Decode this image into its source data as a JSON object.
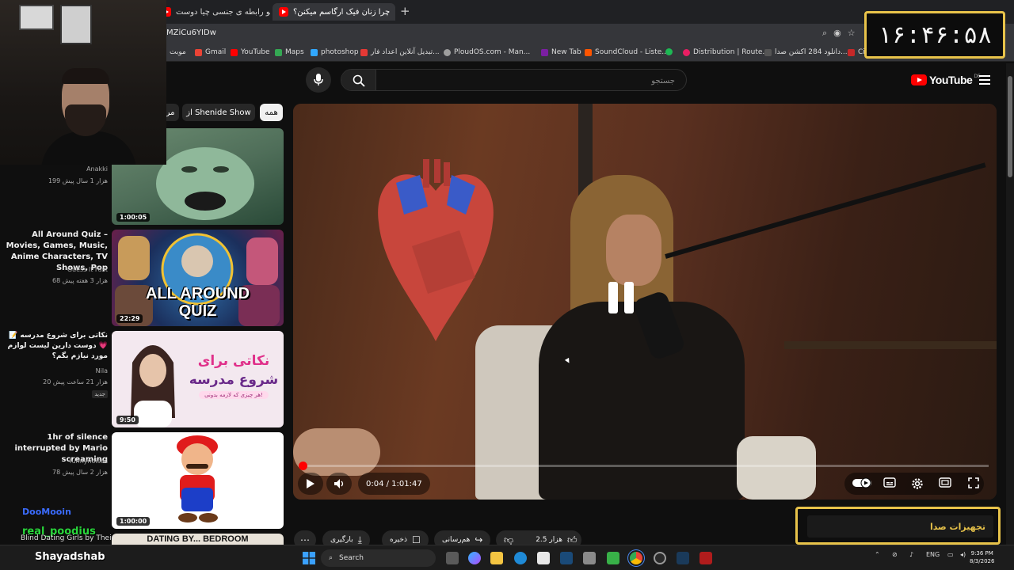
{
  "browser": {
    "tabs": [
      {
        "title": "مزدها تو رابطه ی جنسی چیا دوست...",
        "active": false
      },
      {
        "title": "چرا زنان فیک ارگاسم میکنن؟",
        "active": true
      }
    ],
    "url": "MZiCu6YIDw",
    "bookmarks": [
      {
        "label": "موبت",
        "color": "#9aa0a6"
      },
      {
        "label": "Gmail",
        "color": "#ea4335"
      },
      {
        "label": "YouTube",
        "color": "#ff0000"
      },
      {
        "label": "Maps",
        "color": "#34a853"
      },
      {
        "label": "photoshop",
        "color": "#31a8ff"
      },
      {
        "label": "تبدیل آنلاین اعداد فار...",
        "color": "#e53935"
      },
      {
        "label": "PloudOS.com - Man...",
        "color": "#9e9e9e"
      },
      {
        "label": "New Tab",
        "color": "#7b1fa2"
      },
      {
        "label": "SoundCloud - Liste...",
        "color": "#ff5500"
      },
      {
        "label": "",
        "color": "#1db954"
      },
      {
        "label": "Distribution | Route...",
        "color": "#e91e63"
      },
      {
        "label": "دانلود 284 اکشن صدا...",
        "color": "#555555"
      },
      {
        "label": "Ci",
        "color": "#c62828"
      }
    ]
  },
  "clock_overlay": "۱۶:۴۶:۵۸",
  "youtube": {
    "search_placeholder": "جستجو",
    "logo_text": "YouTube",
    "logo_country": "DE",
    "chips": [
      {
        "label": "همه",
        "selected": true
      },
      {
        "label": "از Shenide Show",
        "selected": false
      },
      {
        "label": "مر",
        "selected": false
      }
    ],
    "recommendations": [
      {
        "title": "",
        "channel": "Anakki",
        "meta": "199 هزار   1 سال پیش",
        "duration": "1:00:05",
        "badge": ""
      },
      {
        "title": "All Around Quiz – Movies, Games, Music, Anime Characters, TV Shows, Pop",
        "channel": "Guess It Fast",
        "meta": "68 هزار   3 هفته پیش",
        "duration": "22:29",
        "badge": ""
      },
      {
        "title": "نکاتی برای شروع مدرسه 📝💗 دوست دارین لیست لوازم مورد نیازم بگم؟",
        "channel": "Nila",
        "meta": "20 هزار   21 ساعت پیش",
        "duration": "9:50",
        "badge": "جدید"
      },
      {
        "title": "1hr of silence interrupted by Mario screaming",
        "channel": "funnynoises",
        "meta": "78 هزار   2 سال پیش",
        "duration": "1:00:00",
        "badge": ""
      }
    ],
    "thumb_texts": {
      "quiz_line1": "ALL AROUND",
      "quiz_line2": "QUIZ",
      "school_line1": "نکاتی برای",
      "school_line2": "شروع مدرسه",
      "school_sub": "هر چیزی که لازمه بدونی!",
      "partial_title": "DATING BY... BEDROOM"
    },
    "player": {
      "current_time": "0:04",
      "duration": "1:01:47",
      "time_display": "0:04 / 1:01:47",
      "progress_fraction": 0.001
    },
    "actions": {
      "like_count": "2.5 هزار",
      "share": "هم‌رسانی",
      "save": "ذخیره",
      "download": "بارگیری"
    }
  },
  "overlays": {
    "banner_text": "تجهیزات صدا",
    "chat": [
      {
        "text": "DooMooin",
        "color": "#3b6cff"
      },
      {
        "text": "real_poodius",
        "color": "#29d63b"
      },
      {
        "text": "Blind Dating Girls by Their",
        "color": "#dddddd"
      },
      {
        "text": "Shayadshab",
        "color": "#ffffff"
      }
    ]
  },
  "taskbar": {
    "search_label": "Search",
    "language": "ENG",
    "time": "9:36 PM",
    "date": "8/3/2026"
  }
}
